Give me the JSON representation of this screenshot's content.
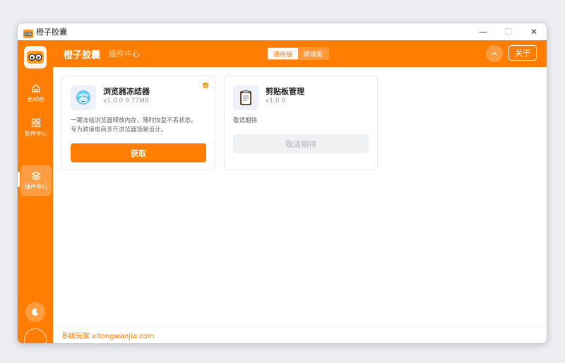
{
  "window": {
    "title": "橙子胶囊",
    "controls": {
      "minimize": "—",
      "maximize": "☐",
      "close": "✕"
    }
  },
  "header": {
    "brand": "橙子胶囊",
    "section": "插件中心",
    "about_label": "关于"
  },
  "edition_tabs": [
    {
      "label": "通用版",
      "active": true
    },
    {
      "label": "跨境版",
      "active": false
    }
  ],
  "sidebar": {
    "items": [
      {
        "label": "启动台",
        "icon": "home-icon",
        "active": false
      },
      {
        "label": "软件中心",
        "icon": "grid-icon",
        "active": false
      },
      {
        "label": "插件中心",
        "icon": "layers-icon",
        "active": true
      }
    ],
    "theme_icon": "moon-icon"
  },
  "plugins": [
    {
      "name": "浏览器冻结器",
      "version": "v1.0.0  9.77MB",
      "desc_line1": "一键冻结浏览器释放内存，随时恢复不丢状态。",
      "desc_line2": "专为跨境电商多开浏览器场景设计。",
      "button": "获取",
      "verified": true,
      "icon": "freeze-face-icon"
    },
    {
      "name": "剪贴板管理",
      "version": "v1.0.0",
      "desc_line1": "敬请期待",
      "desc_line2": "",
      "button": "敬请期待",
      "verified": false,
      "icon": "clipboard-icon"
    }
  ],
  "footer": {
    "text": "系统玩家 xitongwanjia.com"
  },
  "colors": {
    "accent": "#ff7d00",
    "background": "#ffffff",
    "disabled_button": "#f0f1f3"
  }
}
